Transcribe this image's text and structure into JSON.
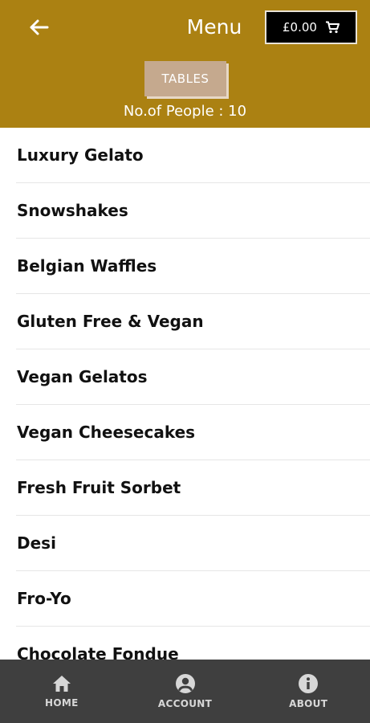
{
  "header": {
    "title": "Menu",
    "cart_total": "£0.00",
    "back_icon": "arrow-left-icon",
    "cart_icon": "cart-icon",
    "tables_label": "TABLES",
    "people_text": "No.of People : 10"
  },
  "menu": {
    "items": [
      {
        "label": "Luxury Gelato"
      },
      {
        "label": "Snowshakes"
      },
      {
        "label": "Belgian Waffles"
      },
      {
        "label": "Gluten Free & Vegan"
      },
      {
        "label": "Vegan Gelatos"
      },
      {
        "label": "Vegan Cheesecakes"
      },
      {
        "label": "Fresh Fruit Sorbet"
      },
      {
        "label": "Desi"
      },
      {
        "label": "Fro-Yo"
      },
      {
        "label": "Chocolate Fondue"
      }
    ]
  },
  "nav": {
    "items": [
      {
        "label": "HOME",
        "icon": "home-icon"
      },
      {
        "label": "ACCOUNT",
        "icon": "account-icon"
      },
      {
        "label": "ABOUT",
        "icon": "info-icon"
      }
    ]
  },
  "colors": {
    "header_bg": "#ab8112",
    "tables_button_bg": "#c5a98e",
    "nav_bg": "#3f3f3f"
  }
}
